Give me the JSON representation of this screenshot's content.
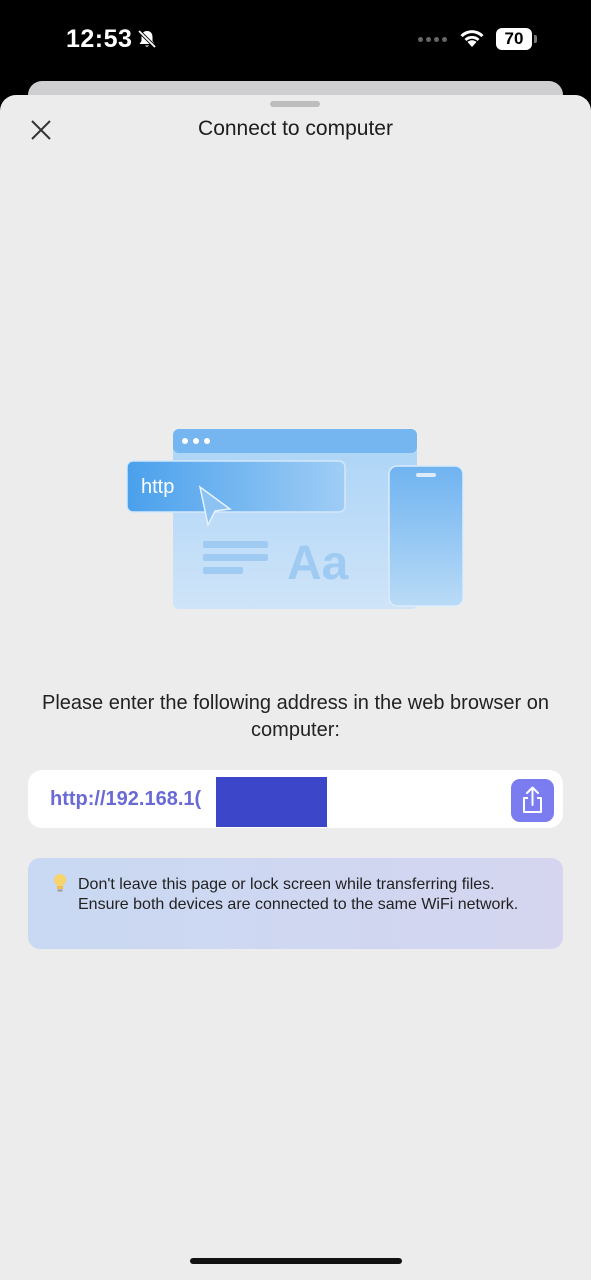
{
  "status_bar": {
    "time": "12:53",
    "battery": "70"
  },
  "sheet": {
    "title": "Connect to computer"
  },
  "illustration": {
    "label_http": "http",
    "label_aa": "Aa"
  },
  "instruction": "Please enter the following address in the web browser on computer:",
  "url": {
    "value": "http://192.168.1("
  },
  "tip": {
    "text": "Don't leave this page or lock screen while transferring files. Ensure both devices are connected to the same WiFi network."
  },
  "colors": {
    "accent": "#7a7cf0",
    "url_text": "#6a6ad6",
    "sheet_bg": "#ececed",
    "tip_bg": "#cfd8f2"
  }
}
